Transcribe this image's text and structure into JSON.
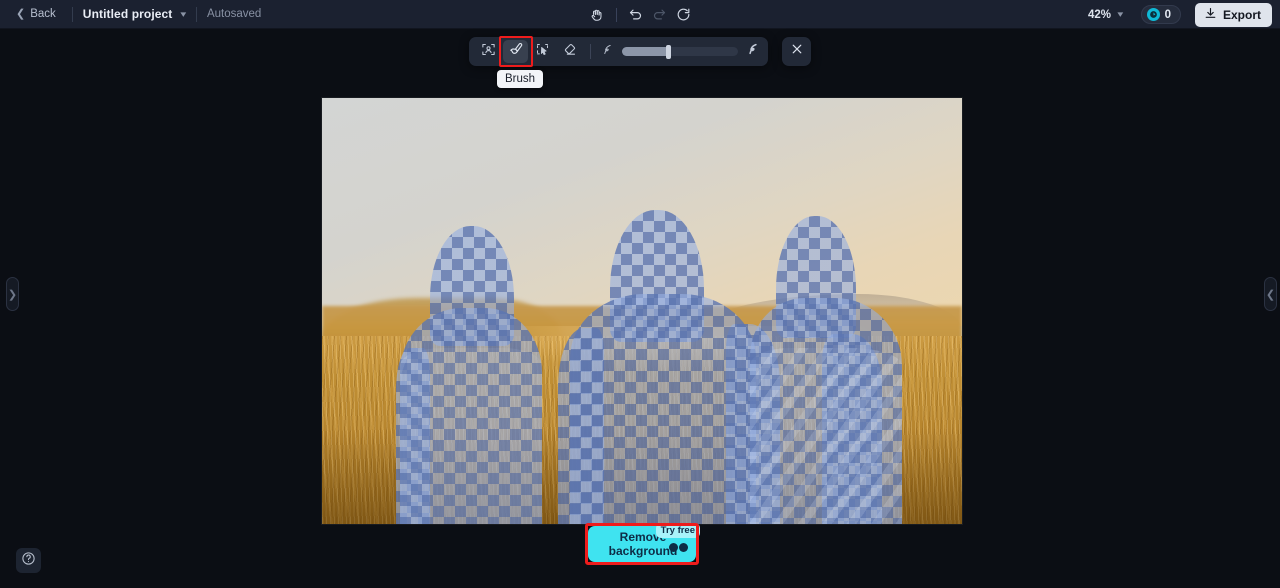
{
  "header": {
    "back_label": "Back",
    "project_name": "Untitled project",
    "autosaved_label": "Autosaved",
    "zoom_level": "42%",
    "credits_count": "0",
    "export_label": "Export",
    "icons": {
      "back_chevron": "chevron-left-icon",
      "project_chevron": "chevron-down-icon",
      "hand": "hand-tool-icon",
      "undo": "undo-icon",
      "redo": "redo-icon",
      "reset": "reset-icon",
      "zoom_chevron": "chevron-down-icon",
      "credit_coin": "credit-coin-icon",
      "export": "download-icon"
    }
  },
  "toolbar": {
    "tools": [
      {
        "name": "select-subject-tool",
        "icon": "portrait-select-icon",
        "active": false
      },
      {
        "name": "brush-tool",
        "icon": "brush-icon",
        "active": true
      },
      {
        "name": "magic-select-tool",
        "icon": "cursor-select-icon",
        "active": false
      },
      {
        "name": "eraser-tool",
        "icon": "eraser-icon",
        "active": false
      }
    ],
    "brush_size_small_icon": "brush-small-icon",
    "brush_size_large_icon": "brush-large-icon",
    "brush_size_value": "38",
    "close_icon": "close-icon",
    "tooltip": "Brush"
  },
  "canvas": {
    "description": "Photo of three women seen from behind standing in a golden wheat field at sunset, with a blue checkerboard selection mask covering the three figures",
    "mask_label": "selection-mask-checkerboard"
  },
  "actions": {
    "remove_background_label": "Remove\nbackground",
    "remove_background_line1": "Remove",
    "remove_background_line2": "background",
    "try_free_badge": "Try free",
    "credit_cost_icon": "credit-coins-icon"
  },
  "panels": {
    "left_handle_icon": "chevron-right-icon",
    "right_handle_icon": "chevron-left-icon"
  },
  "help": {
    "icon": "question-circle-icon"
  },
  "colors": {
    "header_bg": "#1b2130",
    "app_bg": "#0b0e14",
    "toolbar_bg": "#222937",
    "accent_cyan": "#3fe3f0",
    "annotation_red": "#ee1c1c",
    "export_bg": "#dfe4ec",
    "mask_blue": "#3a5496"
  }
}
